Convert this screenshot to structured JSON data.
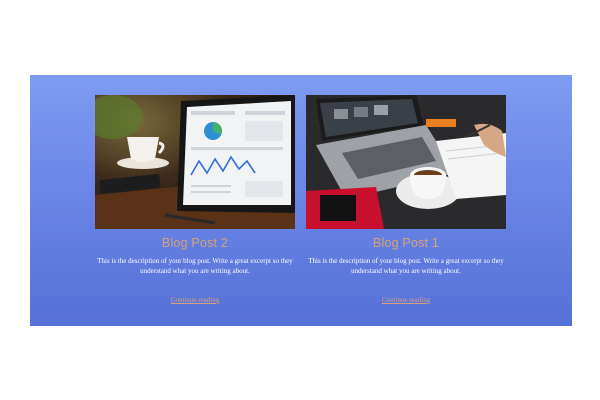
{
  "posts": [
    {
      "title": "Blog Post 2",
      "description": "This is the description of your blog post. Write a great excerpt so they understand what you are writing about.",
      "link_label": "Continue reading"
    },
    {
      "title": "Blog Post 1",
      "description": "This is the description of your blog post. Write a great excerpt so they understand what you are writing about.",
      "link_label": "Continue reading"
    }
  ],
  "colors": {
    "section_gradient_top": "#7e9cf2",
    "section_gradient_bottom": "#5671d7",
    "title_accent": "#d5a27a",
    "body_text": "#ffffff"
  }
}
